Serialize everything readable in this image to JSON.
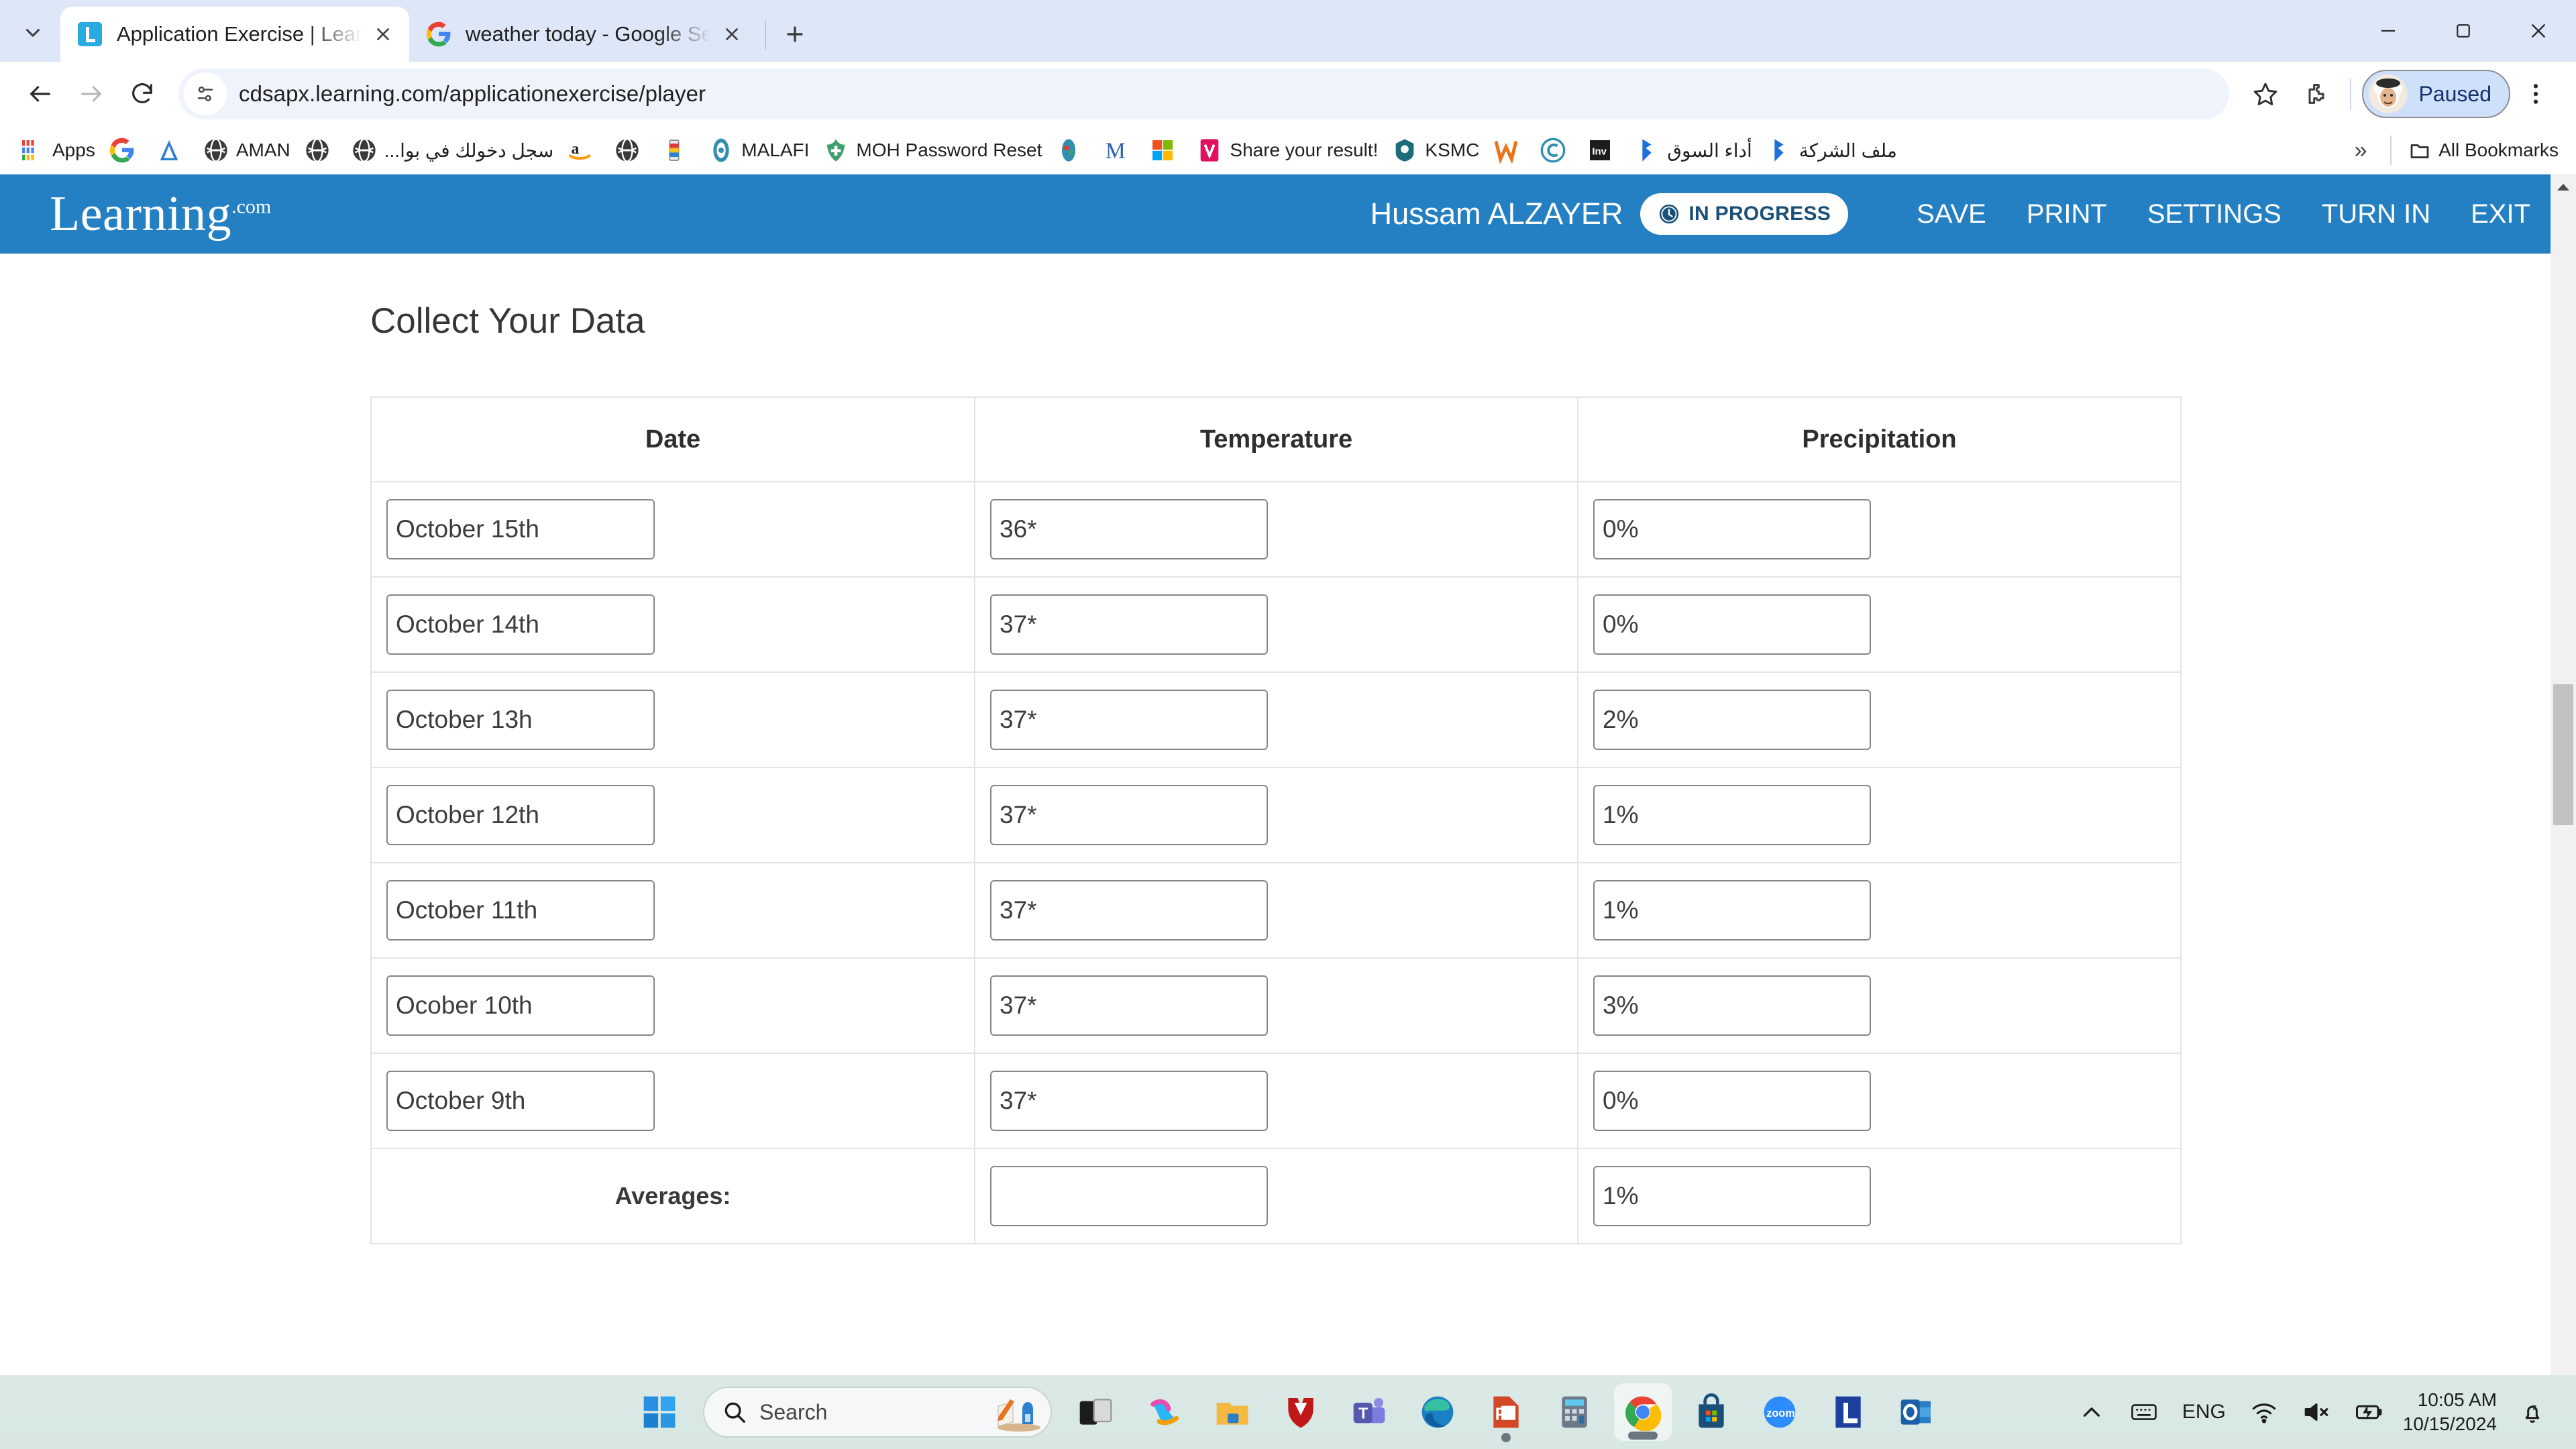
{
  "browser": {
    "tabs": [
      {
        "title": "Application Exercise | Learning.c",
        "favicon": "learning-logo-icon",
        "active": true
      },
      {
        "title": "weather today - Google Search",
        "favicon": "google-g-icon",
        "active": false
      }
    ],
    "newtab_tooltip": "New Tab",
    "omnibox": {
      "url": "cdsapx.learning.com/applicationexercise/player",
      "site_icon": "page-info-icon"
    },
    "profile": {
      "label": "Paused"
    },
    "bookmarks": [
      {
        "label": "Apps",
        "icon": "apps-grid-icon"
      },
      {
        "label": "",
        "icon": "google-g-icon"
      },
      {
        "label": "",
        "icon": "blue-triangle-icon"
      },
      {
        "label": "AMAN",
        "icon": "globe-dark-icon"
      },
      {
        "label": "",
        "icon": "globe-dark-icon"
      },
      {
        "label": "سجل دخولك في بوا...",
        "icon": "globe-dark-icon"
      },
      {
        "label": "",
        "icon": "amazon-icon"
      },
      {
        "label": "",
        "icon": "globe-dark-icon"
      },
      {
        "label": "",
        "icon": "color-bar-icon"
      },
      {
        "label": "MALAFI",
        "icon": "malafi-icon"
      },
      {
        "label": "MOH Password Reset",
        "icon": "moh-icon"
      },
      {
        "label": "",
        "icon": "sphere-icon"
      },
      {
        "label": "",
        "icon": "letter-m-icon"
      },
      {
        "label": "",
        "icon": "windows-squares-icon"
      },
      {
        "label": "Share your result!",
        "icon": "v-pink-icon"
      },
      {
        "label": "KSMC",
        "icon": "ksmc-icon"
      },
      {
        "label": "",
        "icon": "w-orange-icon"
      },
      {
        "label": "",
        "icon": "s-swirl-icon"
      },
      {
        "label": "",
        "icon": "inv-dark-icon"
      },
      {
        "label": "أداء السوق",
        "icon": "blue-flag-icon"
      },
      {
        "label": "ملف الشركة",
        "icon": "blue-flag-icon"
      }
    ],
    "overflow_label": "»",
    "all_bookmarks_label": "All Bookmarks"
  },
  "app": {
    "logo": {
      "word": "Learning",
      "suffix": ".com"
    },
    "user_name": "Hussam ALZAYER",
    "status_badge": {
      "label": "IN PROGRESS",
      "icon": "clock-icon"
    },
    "nav": [
      {
        "label": "SAVE"
      },
      {
        "label": "PRINT"
      },
      {
        "label": "SETTINGS"
      },
      {
        "label": "TURN IN"
      },
      {
        "label": "EXIT"
      }
    ],
    "accent_color": "#2580c3"
  },
  "page": {
    "title": "Collect Your Data",
    "table": {
      "headers": [
        "Date",
        "Temperature",
        "Precipitation"
      ],
      "rows": [
        {
          "date": "October 15th",
          "temperature": "36*",
          "precipitation": "0%"
        },
        {
          "date": "October 14th",
          "temperature": "37*",
          "precipitation": "0%"
        },
        {
          "date": "October 13h",
          "temperature": "37*",
          "precipitation": "2%"
        },
        {
          "date": "October 12th",
          "temperature": "37*",
          "precipitation": "1%"
        },
        {
          "date": "October 11th",
          "temperature": "37*",
          "precipitation": "1%"
        },
        {
          "date": "Ocober 10th",
          "temperature": "37*",
          "precipitation": "3%"
        },
        {
          "date": "October 9th",
          "temperature": "37*",
          "precipitation": "0%"
        }
      ],
      "averages": {
        "label": "Averages:",
        "temperature": "",
        "precipitation": "1%"
      }
    }
  },
  "taskbar": {
    "start_icon": "windows-start-icon",
    "search": {
      "placeholder": "Search",
      "icon": "magnifier-icon"
    },
    "apps": [
      {
        "name": "task-view-icon"
      },
      {
        "name": "copilot-icon"
      },
      {
        "name": "file-explorer-icon"
      },
      {
        "name": "mcafee-icon"
      },
      {
        "name": "microsoft-teams-icon"
      },
      {
        "name": "microsoft-edge-icon"
      },
      {
        "name": "powerpoint-icon"
      },
      {
        "name": "calculator-icon"
      },
      {
        "name": "google-chrome-icon"
      },
      {
        "name": "microsoft-store-icon"
      },
      {
        "name": "zoom-icon"
      },
      {
        "name": "learning-com-icon"
      },
      {
        "name": "outlook-icon"
      }
    ],
    "tray": {
      "language": "ENG",
      "time": "10:05 AM",
      "date": "10/15/2024",
      "icons": [
        "chevron-up-icon",
        "keyboard-icon",
        "wifi-icon",
        "volume-muted-icon",
        "battery-charging-icon",
        "notification-bell-icon"
      ]
    }
  }
}
